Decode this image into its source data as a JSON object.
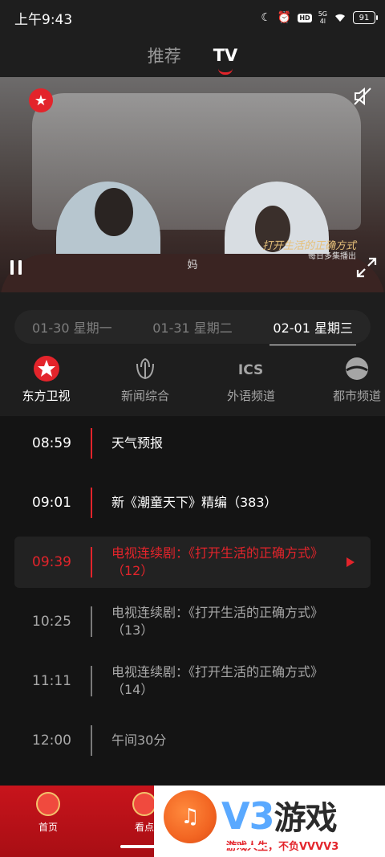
{
  "status_bar": {
    "time": "上午9:43",
    "hd": "HD",
    "net_top": "5G",
    "net_bottom": "4l",
    "battery": "91"
  },
  "top_tabs": [
    {
      "label": "推荐",
      "active": false
    },
    {
      "label": "TV",
      "active": true
    }
  ],
  "player": {
    "subtitle": "妈",
    "show_title": "打开生活的正确方式",
    "show_schedule": "每日多集播出",
    "icons": [
      "channel-logo-icon",
      "mute-icon",
      "pause-icon",
      "fullscreen-icon"
    ]
  },
  "date_tabs": [
    {
      "label": "01-30 星期一",
      "active": false
    },
    {
      "label": "01-31 星期二",
      "active": false
    },
    {
      "label": "02-01 星期三",
      "active": true
    }
  ],
  "channels": [
    {
      "label": "东方卫视",
      "icon": "dragon-tv-icon",
      "active": true
    },
    {
      "label": "新闻综合",
      "icon": "news-channel-icon",
      "active": false
    },
    {
      "label": "外语频道",
      "icon": "ics-channel-icon",
      "active": false
    },
    {
      "label": "都市频道",
      "icon": "city-channel-icon",
      "active": false
    }
  ],
  "programs": [
    {
      "time": "08:59",
      "title": "天气预报",
      "state": "upcoming"
    },
    {
      "time": "09:01",
      "title": "新《潮童天下》精编（383）",
      "state": "upcoming"
    },
    {
      "time": "09:39",
      "title": "电视连续剧：《打开生活的正确方式》（12）",
      "state": "current"
    },
    {
      "time": "10:25",
      "title": "电视连续剧：《打开生活的正确方式》（13）",
      "state": "past"
    },
    {
      "time": "11:11",
      "title": "电视连续剧：《打开生活的正确方式》（14）",
      "state": "past"
    },
    {
      "time": "12:00",
      "title": "午间30分",
      "state": "past"
    }
  ],
  "bottom_nav": [
    {
      "label": "首页"
    },
    {
      "label": "看点"
    }
  ],
  "watermark": {
    "brand": "V3",
    "brand_cn": "游戏",
    "slogan": "游戏人生，不负VVVV3"
  },
  "colors": {
    "accent": "#e3242b",
    "background": "#1e1e1e",
    "schedule_bg": "#141414"
  }
}
